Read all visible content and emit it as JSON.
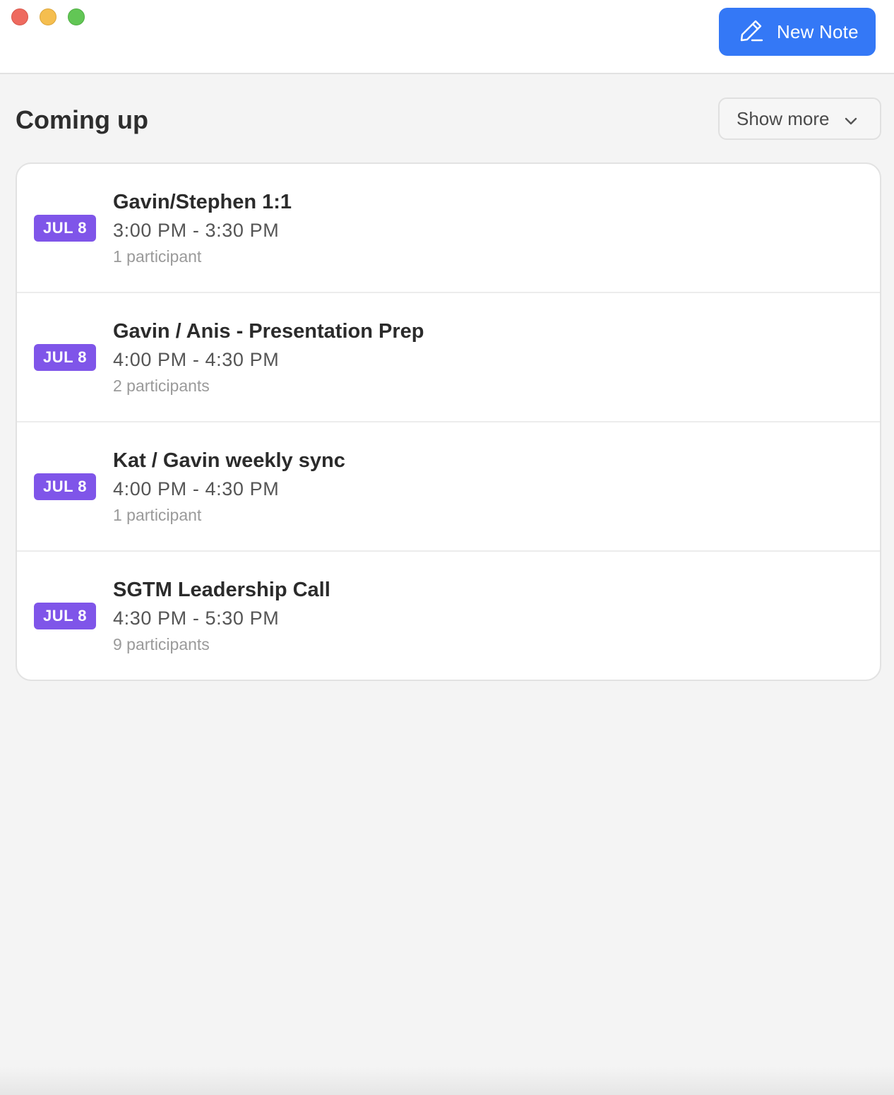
{
  "window": {
    "controls": [
      "close",
      "minimize",
      "maximize"
    ]
  },
  "toolbar": {
    "new_note_label": "New Note",
    "new_note_icon": "pencil-icon",
    "accent_color": "#3478f6"
  },
  "upcoming": {
    "title": "Coming up",
    "show_more_label": "Show more",
    "show_more_icon": "chevron-down-icon",
    "badge_color": "#7f55e9",
    "events": [
      {
        "date": "JUL 8",
        "title": "Gavin/Stephen 1:1",
        "time": "3:00 PM - 3:30 PM",
        "participants": "1 participant"
      },
      {
        "date": "JUL 8",
        "title": "Gavin / Anis - Presentation Prep",
        "time": "4:00 PM - 4:30 PM",
        "participants": "2 participants"
      },
      {
        "date": "JUL 8",
        "title": "Kat / Gavin weekly sync",
        "time": "4:00 PM - 4:30 PM",
        "participants": "1 participant"
      },
      {
        "date": "JUL 8",
        "title": "SGTM Leadership Call",
        "time": "4:30 PM - 5:30 PM",
        "participants": "9 participants"
      }
    ]
  }
}
